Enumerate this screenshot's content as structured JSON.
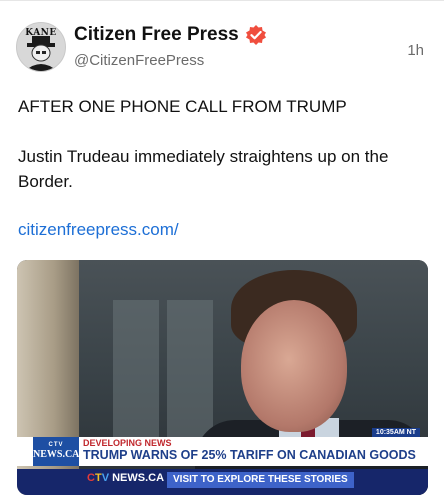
{
  "author": {
    "avatar_text": "KANE",
    "name": "Citizen Free Press",
    "handle": "@CitizenFreePress",
    "verified_icon": "verified-badge-icon",
    "verified_color": "#f04e3e"
  },
  "post": {
    "time": "1h",
    "line1": "AFTER ONE PHONE CALL FROM TRUMP",
    "line2": "Justin Trudeau immediately straightens up on the Border.",
    "link": "citizenfreepress.com/",
    "link_color": "#1d6fd6"
  },
  "media": {
    "timestamp": "10:35AM NT",
    "ctv_small": "CTV",
    "ctv_news": "NEWS.CA",
    "label": "DEVELOPING NEWS",
    "headline": "TRUMP WARNS OF 25% TARIFF ON CANADIAN GOODS",
    "footer_logo_c": "C",
    "footer_logo_t": "T",
    "footer_logo_v": "V",
    "footer_logo_rest": "NEWS.CA",
    "footer_cta": "VISIT TO EXPLORE THESE STORIES"
  }
}
